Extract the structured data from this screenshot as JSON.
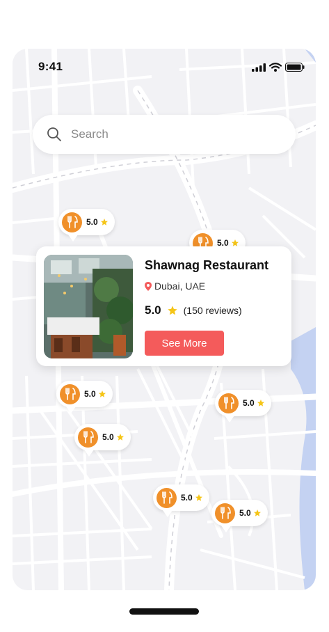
{
  "status_bar": {
    "time": "9:41"
  },
  "search": {
    "placeholder": "Search"
  },
  "restaurant_card": {
    "name": "Shawnag Restaurant",
    "location": "Dubai, UAE",
    "rating": "5.0",
    "reviews": "(150 reviews)",
    "button_label": "See More"
  },
  "map_pins": [
    {
      "rating": "5.0"
    },
    {
      "rating": "5.0"
    },
    {
      "rating": "5.0"
    },
    {
      "rating": "5.0"
    },
    {
      "rating": "5.0"
    },
    {
      "rating": "5.0"
    },
    {
      "rating": "5.0"
    }
  ],
  "colors": {
    "accent": "#f0902a",
    "button": "#f45b5b",
    "star": "#f5c518",
    "water": "#c4d2f2"
  }
}
